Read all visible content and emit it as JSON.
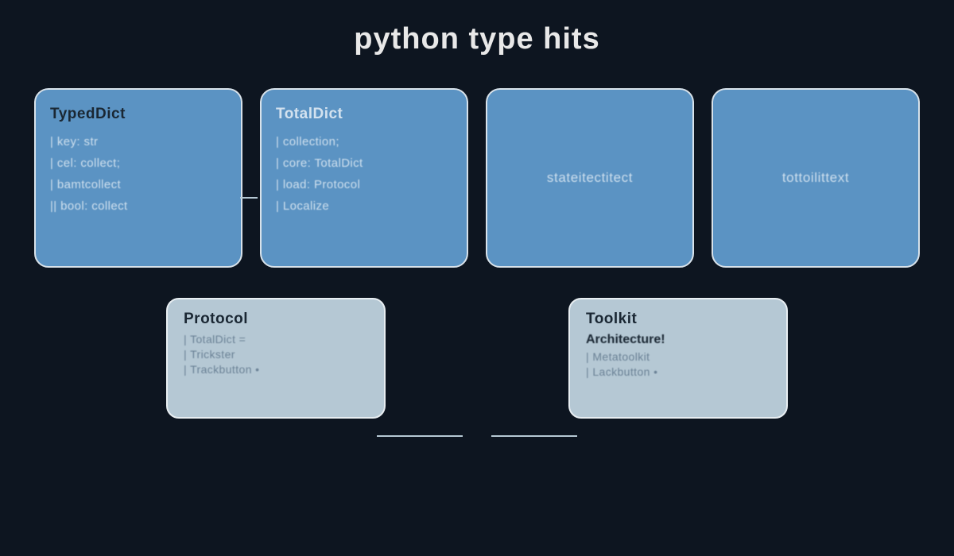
{
  "title": "python type hits",
  "top_row": [
    {
      "heading": "TypedDict",
      "heading_light": false,
      "centered": false,
      "lines": [
        "| key: str",
        "| cel: collect;",
        "| bamtcollect",
        "|| bool: collect"
      ],
      "center_text": null
    },
    {
      "heading": "TotalDict",
      "heading_light": true,
      "centered": false,
      "lines": [
        "| collection;",
        "| core: TotalDict",
        "| load: Protocol",
        "| Localize"
      ],
      "center_text": null
    },
    {
      "heading": null,
      "heading_light": false,
      "centered": true,
      "lines": [],
      "center_text": "stateitectitect"
    },
    {
      "heading": null,
      "heading_light": false,
      "centered": true,
      "lines": [],
      "center_text": "tottoilittext"
    }
  ],
  "bottom_row": [
    {
      "heading": "Protocol",
      "subheading": null,
      "lines": [
        "| TotalDict =",
        "| Trickster",
        "| Trackbutton •"
      ]
    },
    {
      "heading": "Toolkit",
      "subheading": "Architecture!",
      "lines": [
        "| Metatoolkit",
        "| Lackbutton •"
      ]
    }
  ]
}
